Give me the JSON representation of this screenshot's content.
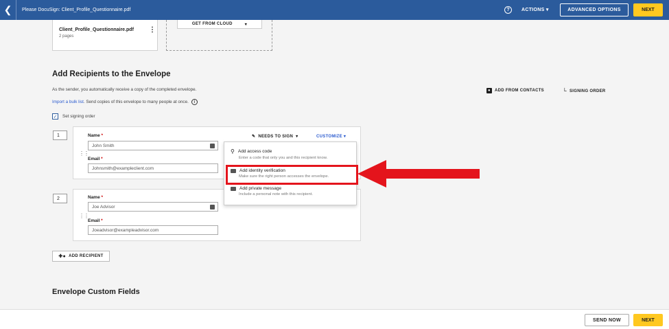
{
  "header": {
    "back_icon": "chevron-left-icon",
    "doc_title": "Please DocuSign: Client_Profile_Questionnaire.pdf",
    "help_icon": "help-circle-icon",
    "actions_label": "ACTIONS",
    "advanced_options_label": "ADVANCED OPTIONS",
    "next_label": "NEXT",
    "brand_color": "#2b5b9c",
    "accent_color": "#ffc820"
  },
  "document": {
    "name": "Client_Profile_Questionnaire.pdf",
    "pages": "2 pages",
    "get_from_cloud_label": "GET FROM CLOUD"
  },
  "recipients_section": {
    "title": "Add Recipients to the Envelope",
    "sender_note": "As the sender, you automatically receive a copy of the completed envelope.",
    "bulk_link": "Import a bulk list",
    "bulk_text": ". Send copies of this envelope to many people at once.",
    "set_signing_order_label": "Set signing order",
    "set_signing_order_checked": true,
    "add_from_contacts_label": "ADD FROM CONTACTS",
    "signing_order_label": "SIGNING ORDER",
    "name_label": "Name",
    "email_label": "Email",
    "recipients": [
      {
        "order": "1",
        "name": "John Smith",
        "email": "Johnsmith@exampleclient.com",
        "action": "NEEDS TO SIGN",
        "customize": "CUSTOMIZE"
      },
      {
        "order": "2",
        "name": "Joe Advisor",
        "email": "Joeadvisor@exampleadvisor.com"
      }
    ],
    "add_recipient_label": "ADD RECIPIENT"
  },
  "customize_menu": {
    "items": [
      {
        "icon": "key-icon",
        "title": "Add access code",
        "desc": "Enter a code that only you and this recipient know."
      },
      {
        "icon": "id-card-icon",
        "title": "Add identity verification",
        "desc": "Make sure the right person accesses the envelope."
      },
      {
        "icon": "message-icon",
        "title": "Add private message",
        "desc": "Include a personal note with this recipient."
      }
    ],
    "highlight_color": "#e4141c"
  },
  "custom_fields": {
    "title": "Envelope Custom Fields"
  },
  "footer": {
    "send_now_label": "SEND NOW",
    "next_label": "NEXT"
  }
}
